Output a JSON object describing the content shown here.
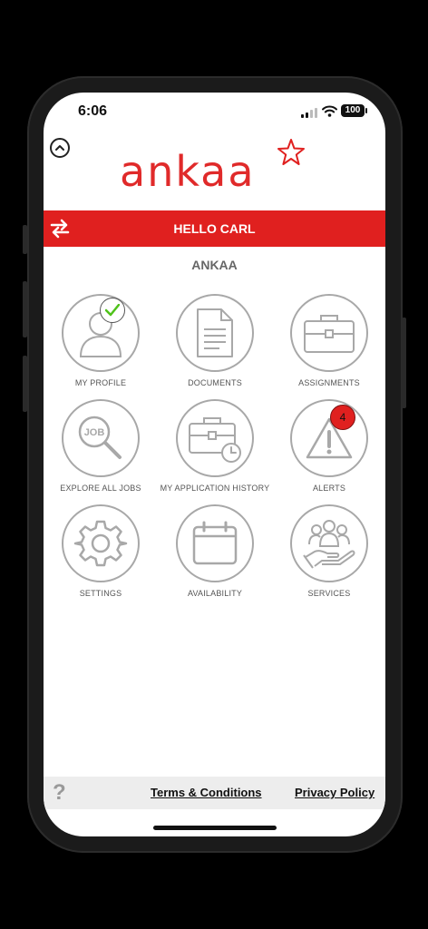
{
  "status_bar": {
    "time": "6:06",
    "battery": "100"
  },
  "brand": {
    "logo_text": "ankaa",
    "accent_color": "#e0201f"
  },
  "header": {
    "greeting": "HELLO CARL",
    "organization": "ANKAA"
  },
  "tiles": [
    {
      "label": "MY PROFILE",
      "icon": "user-icon",
      "badge": "check"
    },
    {
      "label": "DOCUMENTS",
      "icon": "document-icon"
    },
    {
      "label": "ASSIGNMENTS",
      "icon": "briefcase-icon"
    },
    {
      "label": "EXPLORE ALL JOBS",
      "icon": "job-search-icon"
    },
    {
      "label": "MY APPLICATION HISTORY",
      "icon": "briefcase-clock-icon"
    },
    {
      "label": "ALERTS",
      "icon": "warning-icon",
      "badge_count": "4"
    },
    {
      "label": "SETTINGS",
      "icon": "gear-icon"
    },
    {
      "label": "AVAILABILITY",
      "icon": "calendar-icon"
    },
    {
      "label": "SERVICES",
      "icon": "team-hand-icon"
    }
  ],
  "footer": {
    "help": "?",
    "terms": "Terms & Conditions",
    "privacy": "Privacy Policy"
  }
}
